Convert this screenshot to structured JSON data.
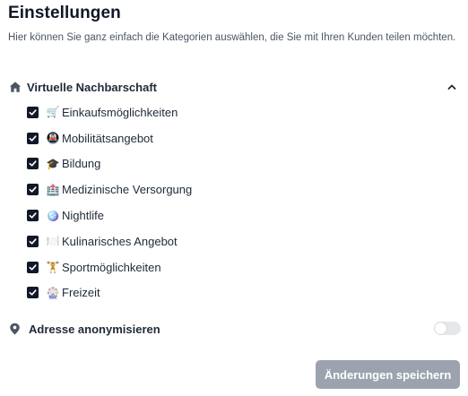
{
  "page": {
    "title": "Einstellungen",
    "subtitle": "Hier können Sie ganz einfach die Kategorien auswählen, die Sie mit Ihren Kunden teilen möchten."
  },
  "section": {
    "title": "Virtuelle Nachbarschaft",
    "icon": "home-icon",
    "expanded": true,
    "items": [
      {
        "emoji": "🛒",
        "label": "Einkaufsmöglichkeiten",
        "checked": true,
        "icon": "shopping-cart-icon"
      },
      {
        "emoji": "🚇",
        "label": "Mobilitätsangebot",
        "checked": true,
        "icon": "metro-icon"
      },
      {
        "emoji": "🎓",
        "label": "Bildung",
        "checked": true,
        "icon": "graduation-cap-icon"
      },
      {
        "emoji": "🏥",
        "label": "Medizinische Versorgung",
        "checked": true,
        "icon": "hospital-icon"
      },
      {
        "emoji": "🪩",
        "label": "Nightlife",
        "checked": true,
        "icon": "disco-ball-icon"
      },
      {
        "emoji": "🍽️",
        "label": "Kulinarisches Angebot",
        "checked": true,
        "icon": "plate-cutlery-icon"
      },
      {
        "emoji": "🏋️",
        "label": "Sportmöglichkeiten",
        "checked": true,
        "icon": "weightlifter-icon"
      },
      {
        "emoji": "🎡",
        "label": "Freizeit",
        "checked": true,
        "icon": "ferris-wheel-icon"
      }
    ]
  },
  "anonymize": {
    "label": "Adresse anonymisieren",
    "enabled": false,
    "icon": "location-pin-icon"
  },
  "save_button": {
    "label": "Änderungen speichern"
  },
  "colors": {
    "checkbox": "#111827",
    "button_disabled": "#9ca3af",
    "toggle_off": "#e5e7eb"
  }
}
